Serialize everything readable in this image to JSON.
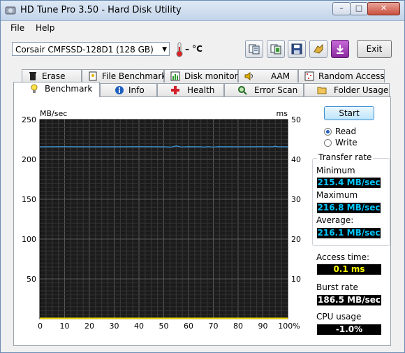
{
  "window": {
    "title": "HD Tune Pro 3.50 - Hard Disk Utility",
    "minimize_label": "–",
    "maximize_label": "□",
    "close_label": "✕"
  },
  "menu": {
    "file": "File",
    "help": "Help"
  },
  "toolbar": {
    "drive": "Corsair CMFSSD-128D1 (128 GB)",
    "temperature": "– °C",
    "exit_label": "Exit",
    "buttons": [
      "copy-info-icon",
      "copy-screenshot-icon",
      "save-icon",
      "options-icon",
      "download-icon"
    ]
  },
  "tabs": {
    "row1": [
      {
        "label": "Erase",
        "icon": "trash-icon"
      },
      {
        "label": "File Benchmark",
        "icon": "file-benchmark-icon"
      },
      {
        "label": "Disk monitor",
        "icon": "disk-monitor-icon"
      },
      {
        "label": "AAM",
        "icon": "speaker-icon"
      },
      {
        "label": "Random Access",
        "icon": "random-access-icon"
      }
    ],
    "row2": [
      {
        "label": "Benchmark",
        "icon": "bulb-icon",
        "active": true
      },
      {
        "label": "Info",
        "icon": "info-icon"
      },
      {
        "label": "Health",
        "icon": "health-cross-icon"
      },
      {
        "label": "Error Scan",
        "icon": "magnifier-icon"
      },
      {
        "label": "Folder Usage",
        "icon": "folder-icon"
      }
    ]
  },
  "controls": {
    "start_label": "Start",
    "read_label": "Read",
    "write_label": "Write",
    "selected_mode": "Read"
  },
  "results": {
    "group_title": "Transfer rate",
    "minimum_label": "Minimum",
    "minimum_value": "215.4 MB/sec",
    "maximum_label": "Maximum",
    "maximum_value": "216.8 MB/sec",
    "average_label": "Average:",
    "average_value": "216.1 MB/sec",
    "access_label": "Access time:",
    "access_value": "0.1 ms",
    "burst_label": "Burst rate",
    "burst_value": "186.5 MB/sec",
    "cpu_label": "CPU usage",
    "cpu_value": "-1.0%"
  },
  "chart_data": {
    "type": "line",
    "left_unit": "MB/sec",
    "right_unit": "ms",
    "y_left_ticks": [
      "250",
      "200",
      "150",
      "100",
      "50"
    ],
    "y_right_ticks": [
      "50",
      "40",
      "30",
      "20",
      "10"
    ],
    "x_ticks": [
      "0",
      "10",
      "20",
      "30",
      "40",
      "50",
      "60",
      "70",
      "80",
      "90",
      "100%"
    ],
    "ylim_left": [
      0,
      250
    ],
    "ylim_right": [
      0,
      50
    ],
    "xlim": [
      0,
      100
    ],
    "grid": true,
    "series": [
      {
        "color": "#3fa0e8",
        "x": [
          0,
          10,
          20,
          30,
          40,
          50,
          53,
          55,
          57,
          60,
          65,
          66,
          68,
          70,
          72,
          80,
          90,
          94,
          95,
          96,
          100
        ],
        "y": [
          215.8,
          215.9,
          215.8,
          215.8,
          215.9,
          215.8,
          215.4,
          216.8,
          215.6,
          215.9,
          215.8,
          215.4,
          216.0,
          215.5,
          215.9,
          215.8,
          215.9,
          215.8,
          216.6,
          215.8,
          215.8
        ]
      },
      {
        "color": "#e6d200",
        "axis": "right",
        "x": [
          0,
          100
        ],
        "y": [
          0.1,
          0.1
        ]
      }
    ]
  }
}
